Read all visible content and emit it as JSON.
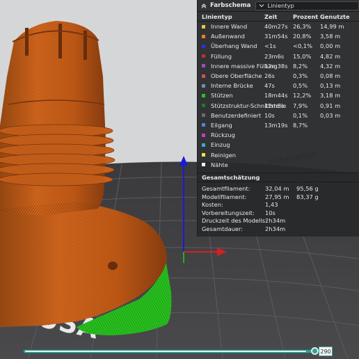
{
  "panel": {
    "schema_label": "Farbschema",
    "schema_value": "Linientyp",
    "columns": {
      "type": "Linientyp",
      "time": "Zeit",
      "percent": "Prozent",
      "used": "Genutzte"
    },
    "rows": [
      {
        "label": "Innere Wand",
        "color": "#e8c547",
        "time": "40m27s",
        "percent": "26,3%",
        "used": "14,99 m"
      },
      {
        "label": "Außenwand",
        "color": "#f07b22",
        "time": "31m54s",
        "percent": "20,8%",
        "used": "3,58 m"
      },
      {
        "label": "Überhang Wand",
        "color": "#2f2fd8",
        "time": "<1s",
        "percent": "<0,1%",
        "used": "0,00 m"
      },
      {
        "label": "Füllung",
        "color": "#b8332a",
        "time": "23m6s",
        "percent": "15,0%",
        "used": "4,82 m"
      },
      {
        "label": "Innere massive Füllung",
        "color": "#9a4fb8",
        "time": "12m38s",
        "percent": "8,2%",
        "used": "4,32 m"
      },
      {
        "label": "Obere Oberfläche",
        "color": "#d0524f",
        "time": "26s",
        "percent": "0,3%",
        "used": "0,08 m"
      },
      {
        "label": "Interne Brücke",
        "color": "#6f8fb0",
        "time": "47s",
        "percent": "0,5%",
        "used": "0,13 m"
      },
      {
        "label": "Stützen",
        "color": "#23c420",
        "time": "18m44s",
        "percent": "12,2%",
        "used": "3,18 m"
      },
      {
        "label": "Stützstruktur-Schnittstelle",
        "color": "#1f7a2a",
        "time": "12m5s",
        "percent": "7,9%",
        "used": "0,91 m"
      },
      {
        "label": "Benutzerdefiniert",
        "color": "#6a6a6a",
        "time": "10s",
        "percent": "0,1%",
        "used": "0,03 m"
      },
      {
        "label": "Eilgang",
        "color": "#4a8ad0",
        "time": "13m19s",
        "percent": "8,7%",
        "used": ""
      },
      {
        "label": "Rückzug",
        "color": "#c23ad6",
        "time": "",
        "percent": "",
        "used": ""
      },
      {
        "label": "Einzug",
        "color": "#3aa6d6",
        "time": "",
        "percent": "",
        "used": ""
      },
      {
        "label": "Reinigen",
        "color": "#e6e84a",
        "time": "",
        "percent": "",
        "used": ""
      },
      {
        "label": "Nähte",
        "color": "#f2f2f2",
        "time": "",
        "percent": "",
        "used": ""
      }
    ],
    "summary_title": "Gesamtschätzung",
    "summary": [
      {
        "label": "Gesamtfilament:",
        "value": "32,04 m",
        "value2": "95,56 g"
      },
      {
        "label": "Modellfilament:",
        "value": "27,95 m",
        "value2": "83,37 g"
      },
      {
        "label": "Kosten:",
        "value": "1,43",
        "value2": ""
      },
      {
        "label": "Vorbereitungszeit:",
        "value": "10s",
        "value2": ""
      },
      {
        "label": "Druckzeit des Modells:",
        "value": "2h34m",
        "value2": ""
      },
      {
        "label": "Gesamtdauer:",
        "value": "2h34m",
        "value2": ""
      }
    ]
  },
  "viewport": {
    "plate_watermark": "unbenannt",
    "bed_logo": "PRUSA"
  },
  "slider": {
    "layer": "290",
    "progress": 0.98
  },
  "icons": [
    "collapse-icon",
    "chevron-down-icon"
  ]
}
